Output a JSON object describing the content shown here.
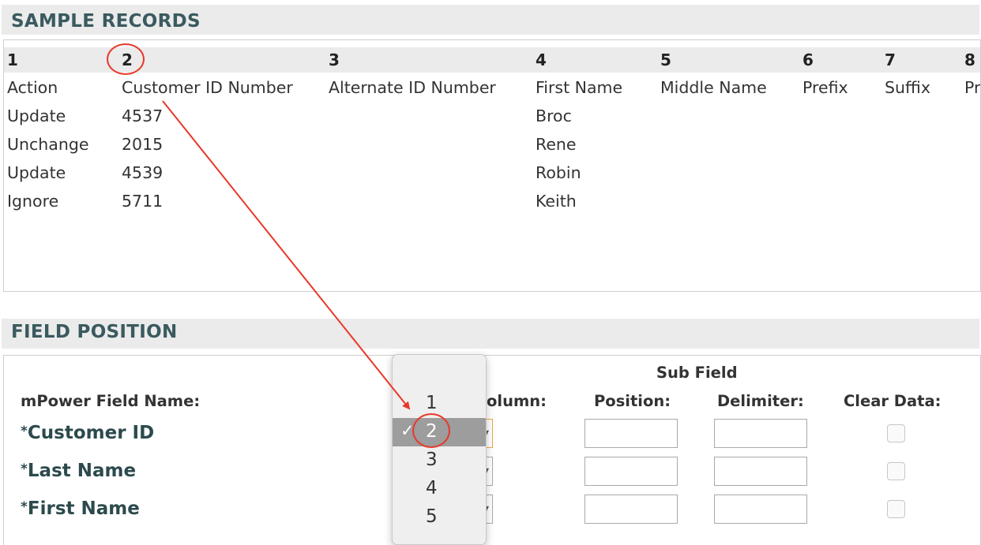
{
  "sample_records": {
    "title": "SAMPLE RECORDS",
    "column_numbers": [
      "1",
      "2",
      "3",
      "4",
      "5",
      "6",
      "7",
      "8"
    ],
    "headers": [
      "Action",
      "Customer ID Number",
      "Alternate ID Number",
      "First Name",
      "Middle Name",
      "Prefix",
      "Suffix",
      "Pr"
    ],
    "rows": [
      {
        "action": "Update",
        "customer_id": "4537",
        "first_name": "Broc"
      },
      {
        "action": "Unchange",
        "customer_id": "2015",
        "first_name": "Rene"
      },
      {
        "action": "Update",
        "customer_id": "4539",
        "first_name": "Robin"
      },
      {
        "action": "Ignore",
        "customer_id": "5711",
        "first_name": "Keith"
      }
    ]
  },
  "field_position": {
    "title": "FIELD POSITION",
    "sub_field_label": "Sub Field",
    "field_name_label": "mPower Field Name:",
    "column_label": "olumn:",
    "position_label": "Position:",
    "delimiter_label": "Delimiter:",
    "clear_data_label": "Clear Data:",
    "required_marker": "*",
    "fields": [
      {
        "name": "Customer ID",
        "selected_column": "2"
      },
      {
        "name": "Last Name"
      },
      {
        "name": "First Name"
      }
    ]
  },
  "column_dropdown": {
    "options": [
      "1",
      "2",
      "3",
      "4",
      "5"
    ],
    "selected": "2",
    "check_glyph": "✓"
  },
  "colors": {
    "section_title": "#3a5a5e",
    "field_name": "#2c4a4d",
    "annotation": "#e8392a",
    "header_bg": "#ebebeb",
    "selected_option_bg": "#9d9d9d"
  }
}
